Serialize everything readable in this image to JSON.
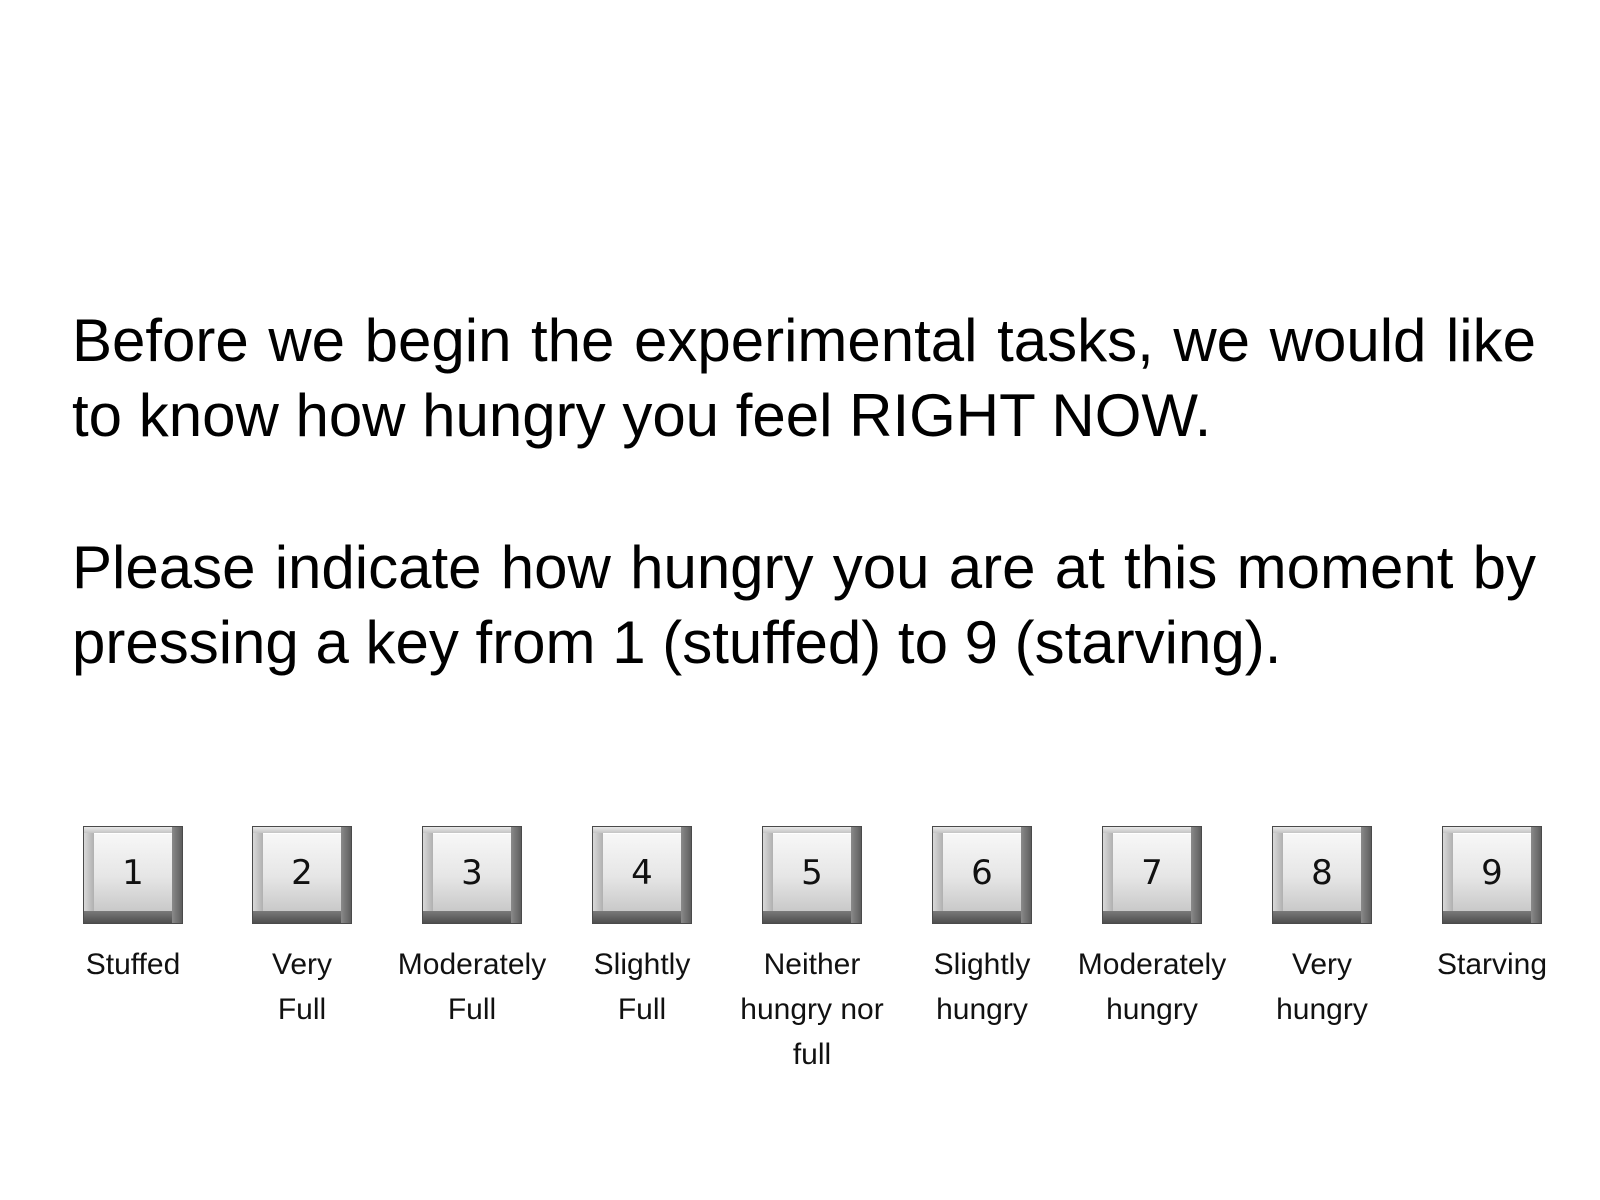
{
  "instructions": {
    "paragraph1": "Before we begin the experimental tasks, we would like to know how hungry you feel RIGHT NOW.",
    "paragraph2": "Please indicate how hungry you are at this moment by pressing a key from 1 (stuffed) to 9 (starving)."
  },
  "scale": {
    "keys": [
      {
        "key": "1",
        "label": "Stuffed"
      },
      {
        "key": "2",
        "label": "Very Full"
      },
      {
        "key": "3",
        "label": "Moderately Full"
      },
      {
        "key": "4",
        "label": "Slightly Full"
      },
      {
        "key": "5",
        "label": "Neither hungry nor full"
      },
      {
        "key": "6",
        "label": "Slightly hungry"
      },
      {
        "key": "7",
        "label": "Moderately hungry"
      },
      {
        "key": "8",
        "label": "Very hungry"
      },
      {
        "key": "9",
        "label": "Starving"
      }
    ]
  }
}
